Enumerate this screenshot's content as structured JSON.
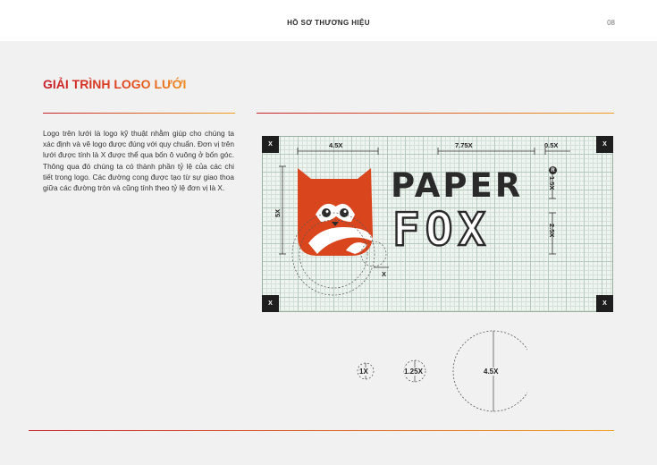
{
  "header": {
    "title": "HỒ SƠ THƯƠNG HIỆU",
    "page_number": "08"
  },
  "section": {
    "title": "GIẢI TRÌNH LOGO LƯỚI"
  },
  "description": "Logo trên lưới là logo kỹ thuật nhằm giúp cho chúng ta xác định và vẽ logo được đúng với quy chuẩn. Đơn vị trên lưới được tính là X được thể qua bốn ô vuông ở bốn góc. Thông qua đó chúng ta có thành phần tỷ lệ của các chi tiết trong logo. Các đường cong được tạo từ sự giao thoa giữa các đường tròn và cũng tính theo tỷ lệ đơn vị là X.",
  "grid": {
    "corner_label": "X",
    "dimensions": {
      "icon_width": "4.5X",
      "text_width": "7.75X",
      "right_margin": "0.5X",
      "icon_height": "5X",
      "paper_height": "1.5X",
      "fox_height": "2.5X",
      "unit": "X"
    },
    "registered_mark": "R"
  },
  "logo": {
    "line1": "PAPER",
    "line2": "FOX"
  },
  "circles": [
    "1X",
    "1.25X",
    "4.5X"
  ],
  "colors": {
    "accent_red": "#c8202a",
    "accent_orange": "#f0a020",
    "fox_orange": "#d9461e",
    "grid_bg": "#eef4ef"
  }
}
